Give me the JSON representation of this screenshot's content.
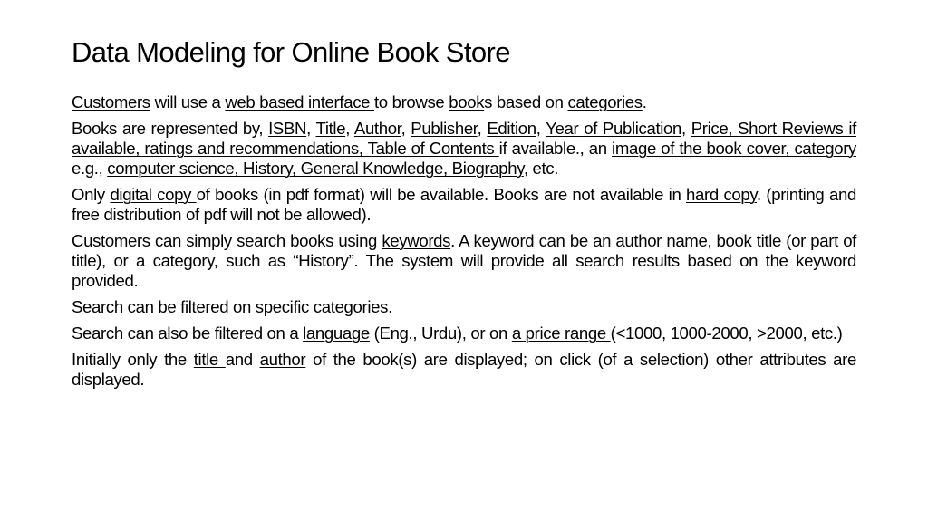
{
  "slide": {
    "title": "Data Modeling for Online Book Store",
    "paragraphs": [
      {
        "runs": [
          {
            "text": "Customers",
            "u": true
          },
          {
            "text": " will use a ",
            "u": false
          },
          {
            "text": "web based interface ",
            "u": true
          },
          {
            "text": "to browse ",
            "u": false
          },
          {
            "text": "book",
            "u": true
          },
          {
            "text": "s based on ",
            "u": false
          },
          {
            "text": "categories",
            "u": true
          },
          {
            "text": ".",
            "u": false
          }
        ]
      },
      {
        "runs": [
          {
            "text": "Books are represented by, ",
            "u": false
          },
          {
            "text": "ISBN",
            "u": true
          },
          {
            "text": ", ",
            "u": false
          },
          {
            "text": "Title",
            "u": true
          },
          {
            "text": ", ",
            "u": false
          },
          {
            "text": "Author",
            "u": true
          },
          {
            "text": ", ",
            "u": false
          },
          {
            "text": "Publisher",
            "u": true
          },
          {
            "text": ", ",
            "u": false
          },
          {
            "text": "Edition",
            "u": true
          },
          {
            "text": ", ",
            "u": false
          },
          {
            "text": "Year of Publication",
            "u": true
          },
          {
            "text": ", ",
            "u": false
          },
          {
            "text": "Price, Short Reviews if available, ratings and recommendations, Table of Contents ",
            "u": true
          },
          {
            "text": "if available., an ",
            "u": false
          },
          {
            "text": "image of the book cover, category ",
            "u": true
          },
          {
            "text": "e.g., ",
            "u": false
          },
          {
            "text": "computer science, History, General Knowledge, Biography",
            "u": true
          },
          {
            "text": ", etc.",
            "u": false
          }
        ]
      },
      {
        "runs": [
          {
            "text": "Only ",
            "u": false
          },
          {
            "text": "digital copy ",
            "u": true
          },
          {
            "text": "of books (in pdf format) will be available. Books are not available in ",
            "u": false
          },
          {
            "text": "hard copy",
            "u": true
          },
          {
            "text": ". (printing and free distribution of pdf will not be allowed).",
            "u": false
          }
        ]
      },
      {
        "runs": [
          {
            "text": "Customers can simply search books using ",
            "u": false
          },
          {
            "text": "keywords",
            "u": true
          },
          {
            "text": ". A keyword can be an author name, book title (or part of title), or a category, such as “History”. The system will provide all search results based on the keyword provided.",
            "u": false
          }
        ]
      },
      {
        "runs": [
          {
            "text": "Search can be filtered on specific categories.",
            "u": false
          }
        ]
      },
      {
        "runs": [
          {
            "text": "Search can also be filtered on a ",
            "u": false
          },
          {
            "text": "language",
            "u": true
          },
          {
            "text": " (Eng., Urdu), or on ",
            "u": false
          },
          {
            "text": "a price range ",
            "u": true
          },
          {
            "text": "(<1000, 1000-2000, >2000, etc.)",
            "u": false
          }
        ]
      },
      {
        "runs": [
          {
            "text": "Initially only the ",
            "u": false
          },
          {
            "text": "title ",
            "u": true
          },
          {
            "text": "and ",
            "u": false
          },
          {
            "text": "author",
            "u": true
          },
          {
            "text": " of the book(s) are displayed; on click (of a selection) other attributes are displayed.",
            "u": false
          }
        ]
      }
    ]
  }
}
